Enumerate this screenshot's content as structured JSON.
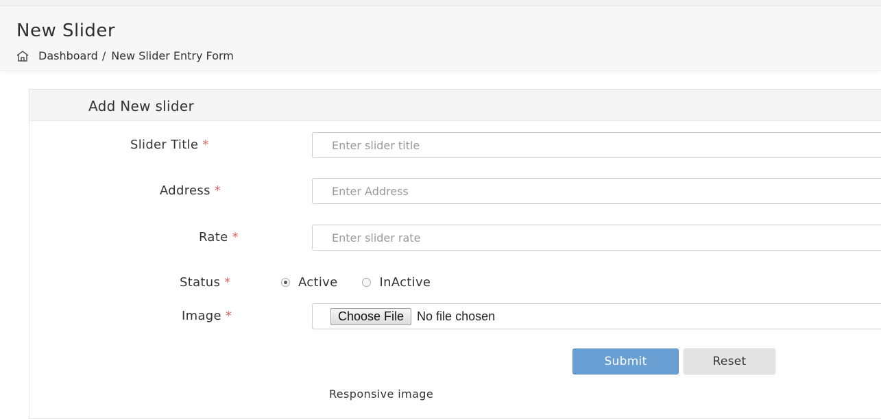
{
  "header": {
    "title": "New Slider",
    "breadcrumb": {
      "home_label": "Dashboard",
      "separator": "/",
      "current": "New Slider Entry Form"
    }
  },
  "panel": {
    "title": "Add New slider"
  },
  "form": {
    "required_mark": "*",
    "slider_title": {
      "label": "Slider Title",
      "placeholder": "Enter slider title",
      "value": ""
    },
    "address": {
      "label": "Address",
      "placeholder": "Enter Address",
      "value": ""
    },
    "rate": {
      "label": "Rate",
      "placeholder": "Enter slider rate",
      "value": ""
    },
    "status": {
      "label": "Status",
      "options": [
        {
          "label": "Active",
          "checked": true
        },
        {
          "label": "InActive",
          "checked": false
        }
      ]
    },
    "image": {
      "label": "Image",
      "button_label": "Choose File",
      "file_status": "No file chosen"
    },
    "submit_label": "Submit",
    "reset_label": "Reset",
    "responsive_image_text": "Responsive image"
  },
  "icons": {
    "home": "home-icon"
  },
  "colors": {
    "primary_button": "#6a9fd4",
    "required_mark": "#e06666"
  }
}
